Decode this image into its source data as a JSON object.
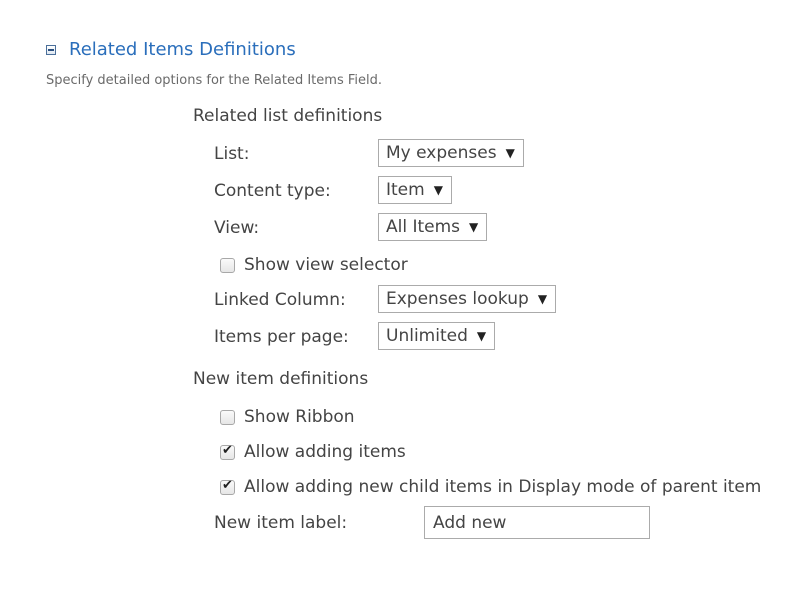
{
  "section": {
    "title": "Related Items Definitions",
    "description": "Specify detailed options for the Related Items Field.",
    "collapse_icon": "minus-box-icon"
  },
  "related_list": {
    "heading": "Related list definitions",
    "list_label": "List:",
    "list_value": "My expenses",
    "content_type_label": "Content type:",
    "content_type_value": "Item",
    "view_label": "View:",
    "view_value": "All Items",
    "show_view_selector_label": "Show view selector",
    "show_view_selector_checked": false,
    "linked_column_label": "Linked Column:",
    "linked_column_value": "Expenses lookup",
    "items_per_page_label": "Items per page:",
    "items_per_page_value": "Unlimited"
  },
  "new_item": {
    "heading": "New item definitions",
    "show_ribbon_label": "Show Ribbon",
    "show_ribbon_checked": false,
    "allow_adding_label": "Allow adding items",
    "allow_adding_checked": true,
    "allow_child_label": "Allow adding new child items in Display mode of parent item",
    "allow_child_checked": true,
    "new_item_label_label": "New item label:",
    "new_item_label_value": "Add new"
  },
  "dropdown_arrow": "▼",
  "colors": {
    "title": "#2a6ebb",
    "text": "#444444",
    "description": "#6a6a6a",
    "border": "#ababab"
  }
}
